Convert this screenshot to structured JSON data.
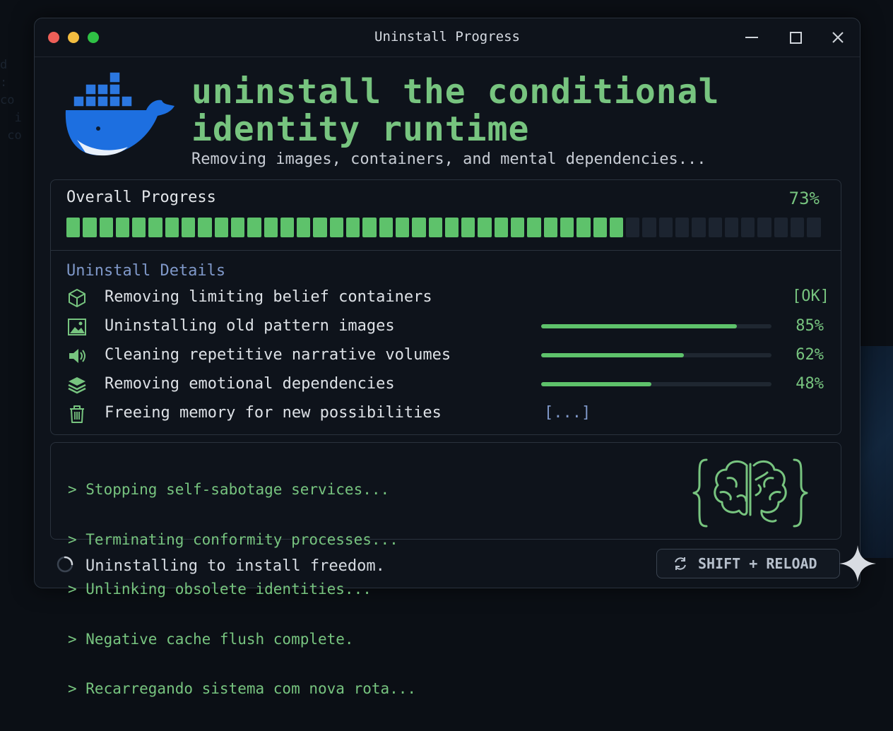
{
  "window": {
    "title": "Uninstall Progress"
  },
  "header": {
    "headline_line1": "uninstall the conditional",
    "headline_line2": "identity runtime",
    "subtitle": "Removing images, containers, and mental dependencies..."
  },
  "progress": {
    "label": "Overall Progress",
    "percent_text": "73%",
    "percent": 73,
    "segments_total": 46,
    "segments_filled": 34
  },
  "details": {
    "title": "Uninstall Details",
    "items": [
      {
        "icon": "cube-icon",
        "label": "Removing limiting belief containers",
        "status": "[OK]"
      },
      {
        "icon": "image-icon",
        "label": "Uninstalling old pattern images",
        "percent_text": "85%",
        "percent": 85
      },
      {
        "icon": "speaker-icon",
        "label": "Cleaning repetitive narrative volumes",
        "percent_text": "62%",
        "percent": 62
      },
      {
        "icon": "layers-icon",
        "label": "Removing emotional dependencies",
        "percent_text": "48%",
        "percent": 48
      },
      {
        "icon": "trash-icon",
        "label": "Freeing memory for new possibilities",
        "status": "[...]"
      }
    ]
  },
  "terminal": {
    "lines": [
      "> Stopping self-sabotage services...",
      "> Terminating conformity processes...",
      "> Unlinking obsolete identities...",
      "> Negative cache flush complete.",
      "> Recarregando sistema com nova rota..."
    ]
  },
  "footer": {
    "status": "Uninstalling to install freedom.",
    "button_label": "SHIFT + RELOAD"
  },
  "colors": {
    "accent": "#5ec26b",
    "text_green": "#77c47f",
    "muted_blue": "#7f98c9",
    "whale_blue": "#1d6fe0"
  }
}
